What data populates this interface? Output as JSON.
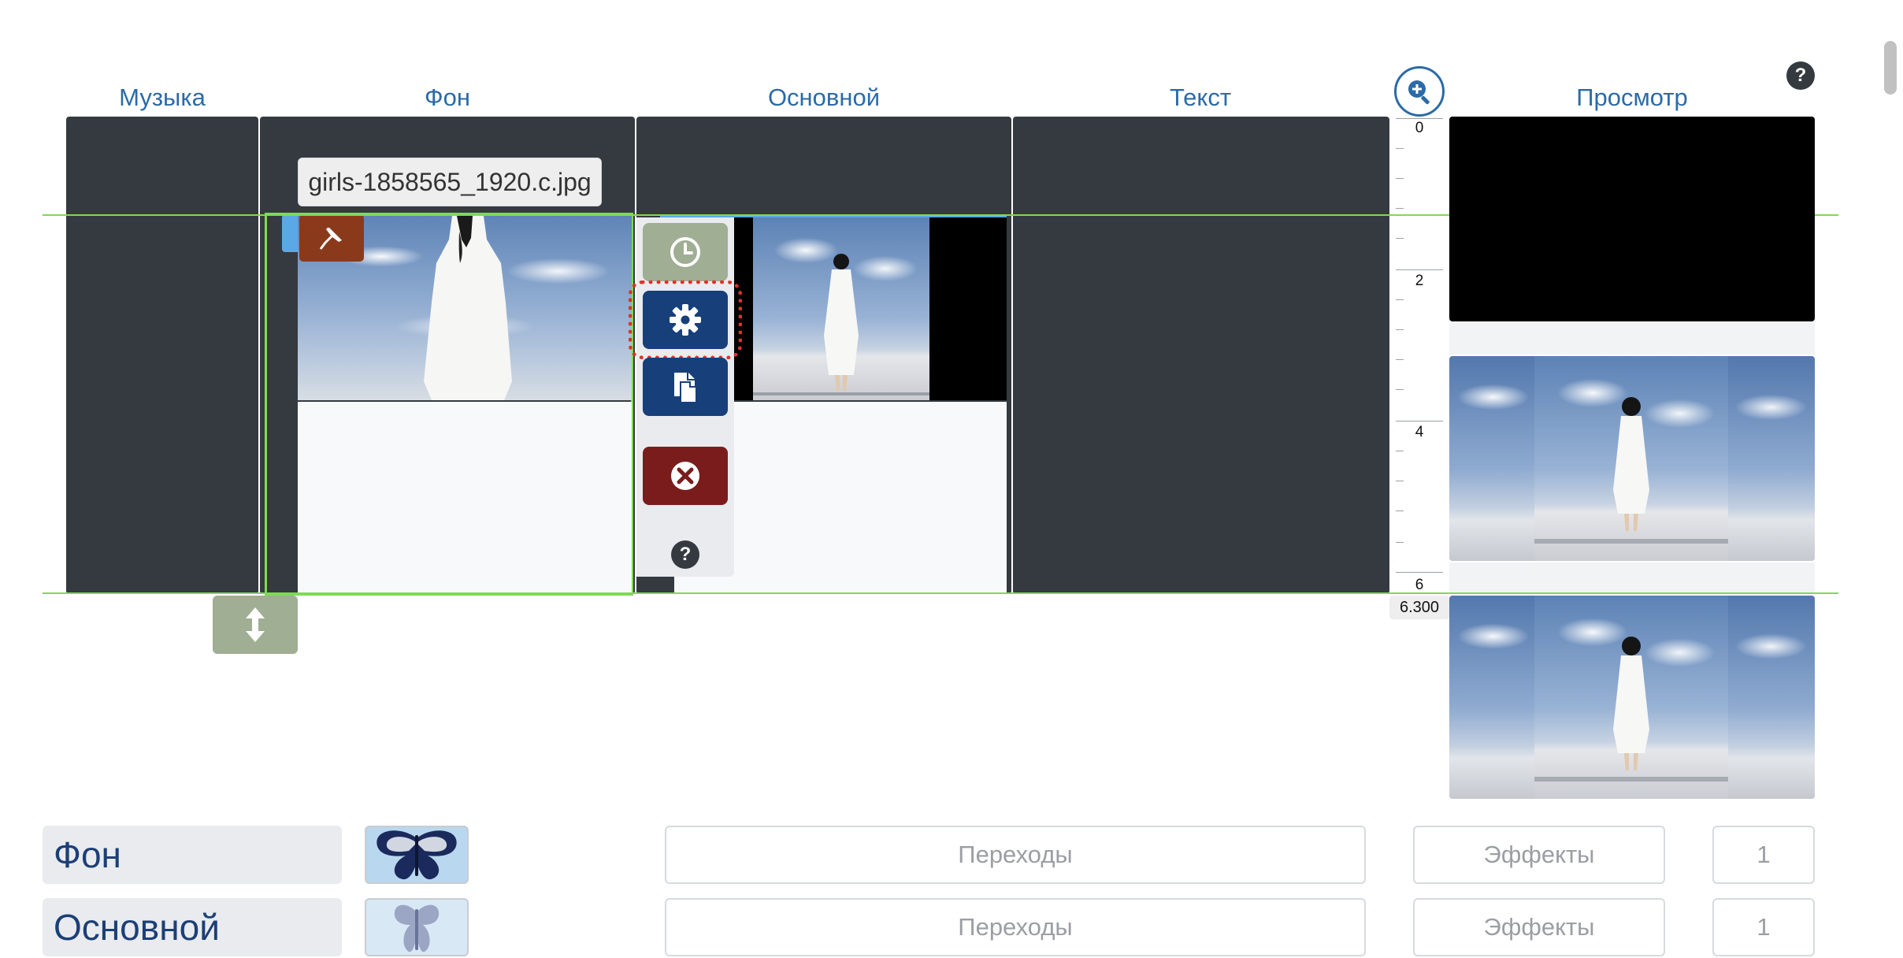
{
  "columns": {
    "music": "Музыка",
    "background": "Фон",
    "main": "Основной",
    "text": "Текст",
    "preview": "Просмотр"
  },
  "help_glyph": "?",
  "filename_tooltip": "girls-1858565_1920.c.jpg",
  "ruler": {
    "labels": [
      "0",
      "2",
      "4",
      "6"
    ],
    "duration": "6.300"
  },
  "tools": [
    "clock-icon",
    "gear-icon",
    "copy-icon",
    "delete-icon",
    "help-icon"
  ],
  "rows": [
    {
      "label": "Фон",
      "transitions": "Переходы",
      "effects": "Эффекты",
      "count": "1"
    },
    {
      "label": "Основной",
      "transitions": "Переходы",
      "effects": "Эффекты",
      "count": "1"
    }
  ],
  "colors": {
    "accent_blue": "#2b6ba8",
    "dark_bg": "#343a40",
    "button_navy": "#173f7a",
    "button_red": "#7a1c1c",
    "button_sage": "#a0ae93",
    "pin_brown": "#8a3a1b",
    "guide_green": "#7ed957",
    "focus_dots": "#e0302a"
  }
}
